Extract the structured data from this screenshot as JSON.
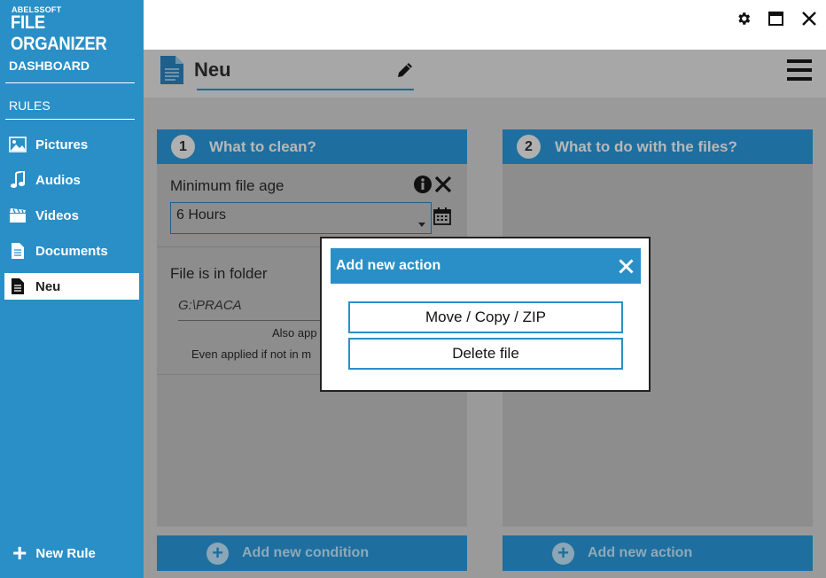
{
  "app": {
    "brand_small": "ABELSSOFT",
    "brand_big": "FILE ORGANIZER"
  },
  "sidebar": {
    "dashboard": "DASHBOARD",
    "rules": "RULES",
    "items": [
      {
        "label": "Pictures",
        "icon": "image-icon"
      },
      {
        "label": "Audios",
        "icon": "music-note-icon"
      },
      {
        "label": "Videos",
        "icon": "clapperboard-icon"
      },
      {
        "label": "Documents",
        "icon": "document-icon"
      },
      {
        "label": "Neu",
        "icon": "document-icon",
        "active": true
      }
    ],
    "new_rule": "New Rule"
  },
  "header": {
    "title": "Neu"
  },
  "panels": {
    "left": {
      "number": "1",
      "title": "What to clean?",
      "min_age_label": "Minimum file age",
      "min_age_value": "6 Hours",
      "folder_label": "File is in folder",
      "folder_path": "G:\\PRACA",
      "also_text": "Also app",
      "even_text": "Even applied if not in m",
      "add_label": "Add new condition"
    },
    "right": {
      "number": "2",
      "title": "What to do with the files?",
      "add_label": "Add new action"
    }
  },
  "modal": {
    "title": "Add new action",
    "buttons": [
      "Move / Copy / ZIP",
      "Delete file"
    ]
  },
  "colors": {
    "accent": "#2a8fc7",
    "panel_header": "#1e6f9f",
    "overlay": "#9a9a9a"
  }
}
